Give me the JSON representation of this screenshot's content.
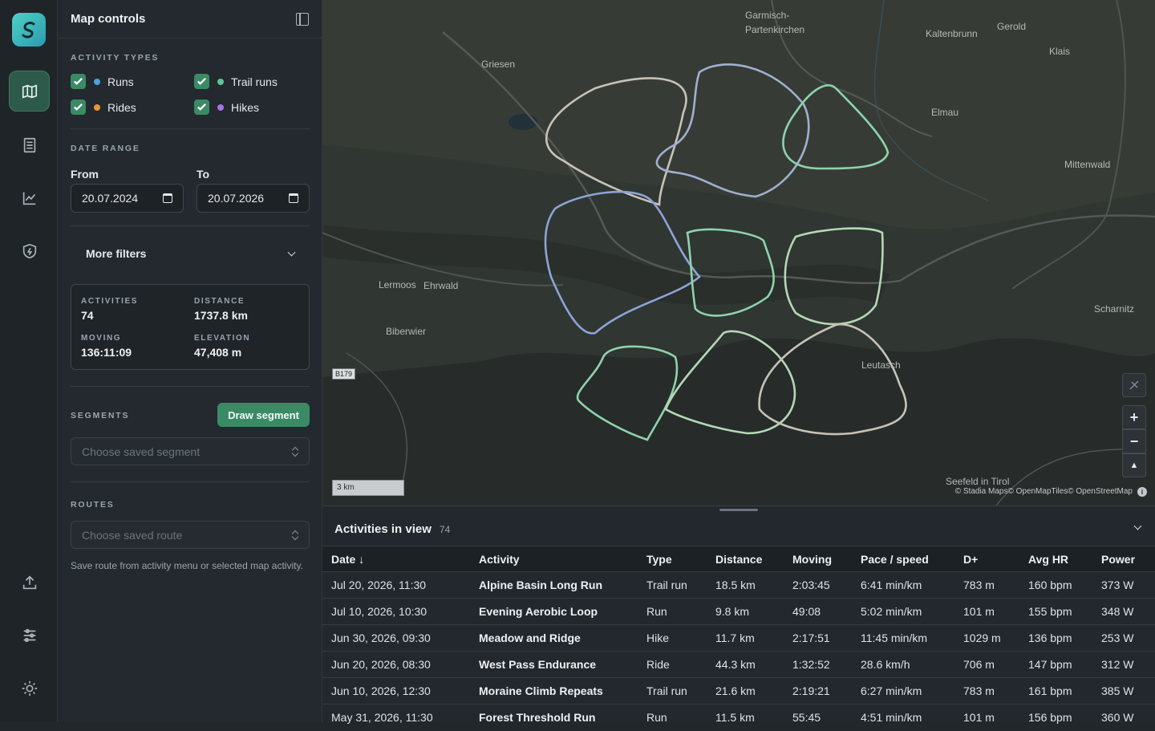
{
  "panel": {
    "title": "Map controls",
    "activity_types_label": "ACTIVITY TYPES",
    "activity_types": [
      {
        "label": "Runs",
        "color": "#4aa3d8",
        "checked": true
      },
      {
        "label": "Trail runs",
        "color": "#5bc59a",
        "checked": true
      },
      {
        "label": "Rides",
        "color": "#e8953a",
        "checked": true
      },
      {
        "label": "Hikes",
        "color": "#a875e0",
        "checked": true
      }
    ],
    "date_range_label": "DATE RANGE",
    "from_label": "From",
    "to_label": "To",
    "from_value": "20.07.2024",
    "to_value": "20.07.2026",
    "more_filters": "More filters",
    "stats": {
      "activities_label": "ACTIVITIES",
      "activities": "74",
      "distance_label": "DISTANCE",
      "distance": "1737.8 km",
      "moving_label": "MOVING",
      "moving": "136:11:09",
      "elevation_label": "ELEVATION",
      "elevation": "47,408 m"
    },
    "segments_label": "SEGMENTS",
    "draw_segment": "Draw segment",
    "segment_placeholder": "Choose saved segment",
    "routes_label": "ROUTES",
    "route_placeholder": "Choose saved route",
    "routes_hint": "Save route from activity menu or selected map activity."
  },
  "map": {
    "places": [
      {
        "text": "Garmisch-",
        "key": "garmisch1"
      },
      {
        "text": "Partenkirchen",
        "key": "garmisch2"
      },
      {
        "text": "Kaltenbrunn",
        "key": "kaltenbrunn"
      },
      {
        "text": "Gerold",
        "key": "gerold"
      },
      {
        "text": "Klais",
        "key": "klais"
      },
      {
        "text": "Griesen",
        "key": "griesen"
      },
      {
        "text": "Elmau",
        "key": "elmau"
      },
      {
        "text": "Mittenwald",
        "key": "mittenwald"
      },
      {
        "text": "Lermoos",
        "key": "lermoos"
      },
      {
        "text": "Ehrwald",
        "key": "ehrwald"
      },
      {
        "text": "Biberwier",
        "key": "biberwier"
      },
      {
        "text": "Scharnitz",
        "key": "scharnitz"
      },
      {
        "text": "Leutasch",
        "key": "leutasch"
      },
      {
        "text": "Seefeld in Tirol",
        "key": "seefeld"
      }
    ],
    "road": "B179",
    "scale": "3 km",
    "attribution": "© Stadia Maps© OpenMapTiles© OpenStreetMap",
    "zoom_in": "+",
    "zoom_out": "−",
    "compass": "▲"
  },
  "activities": {
    "title": "Activities in view",
    "count": "74",
    "columns": [
      "Date ↓",
      "Activity",
      "Type",
      "Distance",
      "Moving",
      "Pace / speed",
      "D+",
      "Avg HR",
      "Power"
    ],
    "rows": [
      [
        "Jul 20, 2026, 11:30",
        "Alpine Basin Long Run",
        "Trail run",
        "18.5 km",
        "2:03:45",
        "6:41 min/km",
        "783 m",
        "160 bpm",
        "373 W"
      ],
      [
        "Jul 10, 2026, 10:30",
        "Evening Aerobic Loop",
        "Run",
        "9.8 km",
        "49:08",
        "5:02 min/km",
        "101 m",
        "155 bpm",
        "348 W"
      ],
      [
        "Jun 30, 2026, 09:30",
        "Meadow and Ridge",
        "Hike",
        "11.7 km",
        "2:17:51",
        "11:45 min/km",
        "1029 m",
        "136 bpm",
        "253 W"
      ],
      [
        "Jun 20, 2026, 08:30",
        "West Pass Endurance",
        "Ride",
        "44.3 km",
        "1:32:52",
        "28.6 km/h",
        "706 m",
        "147 bpm",
        "312 W"
      ],
      [
        "Jun 10, 2026, 12:30",
        "Moraine Climb Repeats",
        "Trail run",
        "21.6 km",
        "2:19:21",
        "6:27 min/km",
        "783 m",
        "161 bpm",
        "385 W"
      ],
      [
        "May 31, 2026, 11:30",
        "Forest Threshold Run",
        "Run",
        "11.5 km",
        "55:45",
        "4:51 min/km",
        "101 m",
        "156 bpm",
        "360 W"
      ]
    ]
  }
}
